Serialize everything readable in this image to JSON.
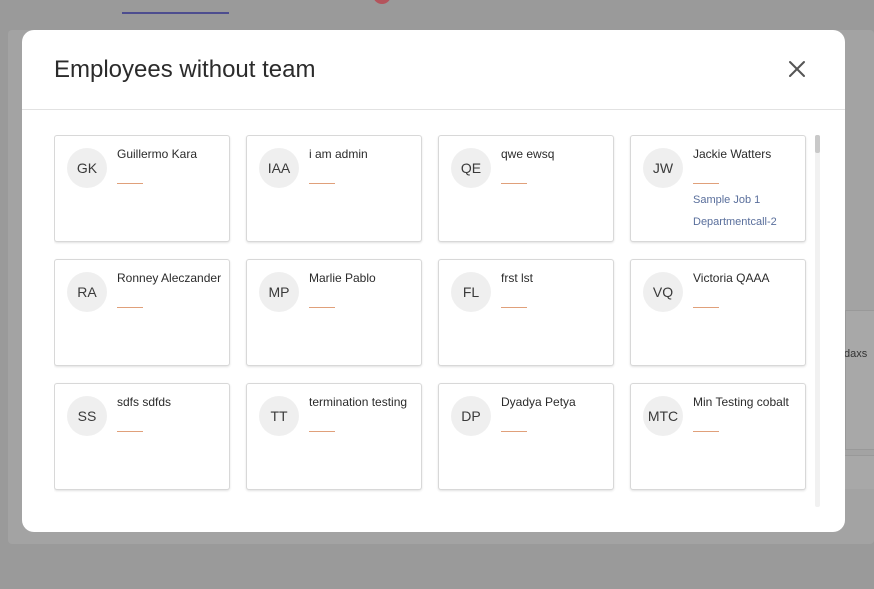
{
  "background": {
    "panel_text": "daxs"
  },
  "modal": {
    "title": "Employees without team",
    "close_icon": "close-icon"
  },
  "employees": [
    {
      "initials": "GK",
      "name": "Guillermo Kara",
      "job": "",
      "department": ""
    },
    {
      "initials": "IAA",
      "name": "i am admin",
      "job": "",
      "department": ""
    },
    {
      "initials": "QE",
      "name": "qwe ewsq",
      "job": "",
      "department": ""
    },
    {
      "initials": "JW",
      "name": "Jackie Watters",
      "job": "Sample Job 1",
      "department": "Departmentcall-2"
    },
    {
      "initials": "RA",
      "name": "Ronney Aleczander",
      "job": "",
      "department": ""
    },
    {
      "initials": "MP",
      "name": "Marlie Pablo",
      "job": "",
      "department": ""
    },
    {
      "initials": "FL",
      "name": "frst lst",
      "job": "",
      "department": ""
    },
    {
      "initials": "VQ",
      "name": "Victoria QAAA",
      "job": "",
      "department": ""
    },
    {
      "initials": "SS",
      "name": "sdfs sdfds",
      "job": "",
      "department": ""
    },
    {
      "initials": "TT",
      "name": "termination testing",
      "job": "",
      "department": ""
    },
    {
      "initials": "DP",
      "name": "Dyadya Petya",
      "job": "",
      "department": ""
    },
    {
      "initials": "MTC",
      "name": "Min Testing cobalt",
      "job": "",
      "department": ""
    }
  ],
  "colors": {
    "accent_line": "#e0a07a",
    "sub_text": "#5a6f9c"
  }
}
